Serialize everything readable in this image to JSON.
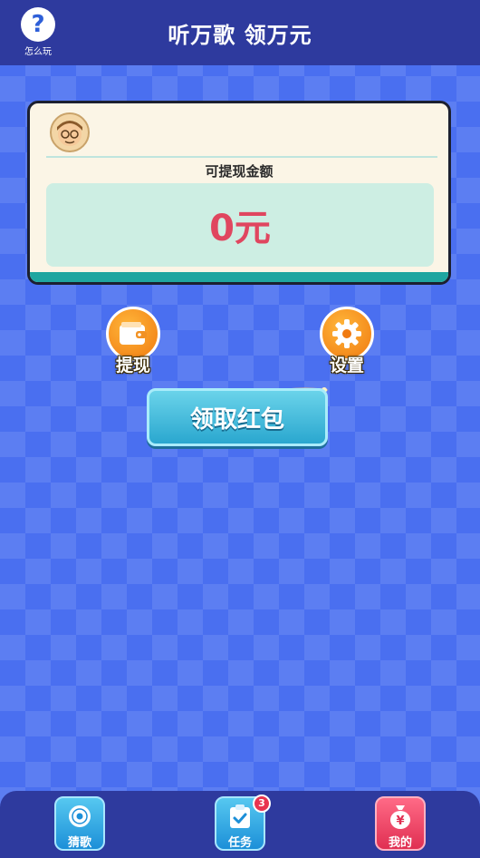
{
  "header": {
    "title": "听万歌 领万元",
    "help_label": "怎么玩",
    "help_icon": "question-mark-icon",
    "help_glyph": "?"
  },
  "card": {
    "label": "可提现金额",
    "amount": "0元"
  },
  "actions": {
    "withdraw_label": "提现",
    "settings_label": "设置",
    "claim_label": "领取红包"
  },
  "bottom_nav": {
    "items": [
      {
        "label": "猜歌",
        "icon": "disc-icon"
      },
      {
        "label": "任务",
        "icon": "clipboard-check-icon",
        "badge": "3"
      },
      {
        "label": "我的",
        "icon": "money-bag-icon",
        "glyph": "¥"
      }
    ]
  },
  "colors": {
    "background": "#4a6ff0",
    "header": "#2e3a9e",
    "amount": "#e0465f",
    "accent_orange": "#f07a10",
    "claim_button": "#2aa7cf"
  }
}
